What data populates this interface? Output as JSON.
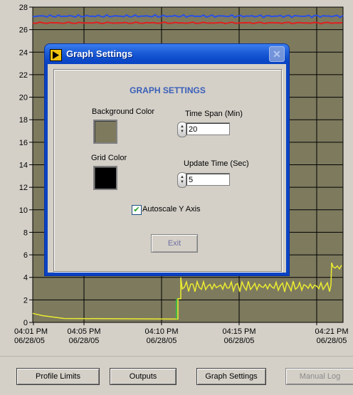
{
  "chart_data": {
    "type": "line",
    "y_ticks": [
      "28",
      "26",
      "24",
      "22",
      "20",
      "18",
      "16",
      "14",
      "12",
      "10",
      "8",
      "6",
      "4",
      "2",
      "0"
    ],
    "ylim": [
      0,
      28
    ],
    "x_ticks": [
      {
        "time": "04:01 PM",
        "date": "06/28/05"
      },
      {
        "time": "04:05 PM",
        "date": "06/28/05"
      },
      {
        "time": "04:10 PM",
        "date": "06/28/05"
      },
      {
        "time": "04:15 PM",
        "date": "06/28/05"
      },
      {
        "time": "04:21 PM",
        "date": "06/28/05"
      }
    ],
    "grid": true,
    "plot_background": "#7d7a5e",
    "series": [
      {
        "color": "#2a4fe6",
        "approx_value": 27.2
      },
      {
        "color": "#e02020",
        "approx_value": 26.6
      },
      {
        "color": "#ecec30",
        "values_note": "0.8 falling to 0.3, step to ~3.3, rising to ~5"
      }
    ]
  },
  "dialog": {
    "title": "Graph Settings",
    "close_symbol": "✕",
    "heading": "GRAPH SETTINGS",
    "background_color_label": "Background Color",
    "background_color_value": "#7d7a5e",
    "grid_color_label": "Grid Color",
    "grid_color_value": "#000000",
    "time_span_label": "Time Span (Min)",
    "time_span_value": "20",
    "update_time_label": "Update Time (Sec)",
    "update_time_value": "5",
    "autoscale_label": "Autoscale Y Axis",
    "autoscale_checked": true,
    "exit_label": "Exit"
  },
  "buttons": {
    "profile_limits": "Profile Limits",
    "outputs": "Outputs",
    "graph_settings": "Graph Settings",
    "manual_log": "Manual Log"
  }
}
